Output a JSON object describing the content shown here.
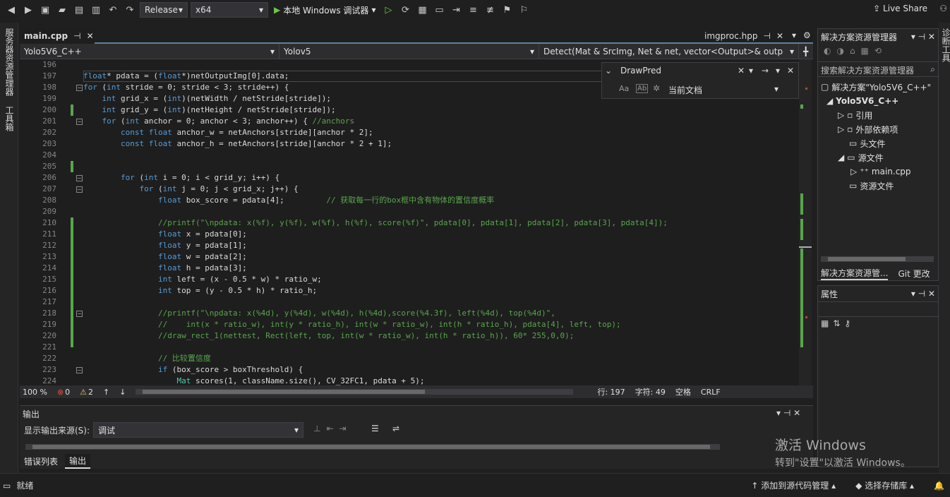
{
  "toolbar": {
    "config": "Release",
    "platform": "x64",
    "run_label": "本地 Windows 调试器",
    "live_share": "Live Share"
  },
  "left_tabs": [
    "服务器资源管理器",
    "工具箱"
  ],
  "right_tabs": [
    "诊断工具"
  ],
  "doc_tabs": {
    "active": "main.cpp",
    "other": "imgproc.hpp"
  },
  "navbar": {
    "project": "Yolo5V6_C++",
    "class": "Yolov5",
    "method": "Detect(Mat & SrcImg, Net & net, vector<Output>& outp"
  },
  "find": {
    "query": "DrawPred",
    "scope": "当前文档",
    "opt_case": "Aa",
    "opt_word": "Ab"
  },
  "code": {
    "line_numbers": [
      "196",
      "197",
      "198",
      "199",
      "200",
      "201",
      "202",
      "203",
      "204",
      "205",
      "206",
      "207",
      "208",
      "209",
      "210",
      "211",
      "212",
      "213",
      "214",
      "215",
      "216",
      "217",
      "218",
      "219",
      "220",
      "221",
      "222",
      "223",
      "224"
    ],
    "lines": [
      "",
      "float* pdata = (float*)netOutputImg[0].data;",
      "for (int stride = 0; stride < 3; stride++) {",
      "    int grid_x = (int)(netWidth / netStride[stride]);",
      "    int grid_y = (int)(netHeight / netStride[stride]);",
      "    for (int anchor = 0; anchor < 3; anchor++) { //anchors",
      "        const float anchor_w = netAnchors[stride][anchor * 2];",
      "        const float anchor_h = netAnchors[stride][anchor * 2 + 1];",
      "",
      "",
      "        for (int i = 0; i < grid_y; i++) {",
      "            for (int j = 0; j < grid_x; j++) {",
      "                float box_score = pdata[4];         // 获取每一行的box框中含有物体的置信度概率",
      "",
      "                //printf(\"\\npdata: x(%f), y(%f), w(%f), h(%f), score(%f)\", pdata[0], pdata[1], pdata[2], pdata[3], pdata[4]);",
      "                float x = pdata[0];",
      "                float y = pdata[1];",
      "                float w = pdata[2];",
      "                float h = pdata[3];",
      "                int left = (x - 0.5 * w) * ratio_w;",
      "                int top = (y - 0.5 * h) * ratio_h;",
      "",
      "                //printf(\"\\npdata: x(%4d), y(%4d), w(%4d), h(%4d),score(%4.3f), left(%4d), top(%4d)\",",
      "                //    int(x * ratio_w), int(y * ratio_h), int(w * ratio_w), int(h * ratio_h), pdata[4], left, top);",
      "                //draw_rect_1(nettest, Rect(left, top, int(w * ratio_w), int(h * ratio_h)), 60* 255,0,0);",
      "",
      "                // 比较置信度",
      "                if (box_score > boxThreshold) {",
      "                    Mat scores(1, className.size(), CV_32FC1, pdata + 5);"
    ]
  },
  "editor_status": {
    "zoom": "100 %",
    "errors": "0",
    "warnings": "2",
    "line": "行: 197",
    "col": "字符: 49",
    "ws": "空格",
    "eol": "CRLF"
  },
  "output": {
    "title": "输出",
    "source_label": "显示输出来源(S):",
    "source_value": "调试",
    "tabs": [
      "错误列表",
      "输出"
    ]
  },
  "solution": {
    "title": "解决方案资源管理器",
    "search_placeholder": "搜索解决方案资源管理器",
    "nodes": [
      "解决方案\"Yolo5V6_C++\"",
      "Yolo5V6_C++",
      "引用",
      "外部依赖项",
      "头文件",
      "源文件",
      "main.cpp",
      "资源文件"
    ],
    "tab1": "解决方案资源管...",
    "tab2": "Git 更改"
  },
  "properties": {
    "title": "属性"
  },
  "status": {
    "ready": "就绪",
    "add_source": "添加到源代码管理",
    "select_repo": "选择存储库"
  },
  "watermark": {
    "line1": "激活 Windows",
    "line2": "转到\"设置\"以激活 Windows。"
  }
}
